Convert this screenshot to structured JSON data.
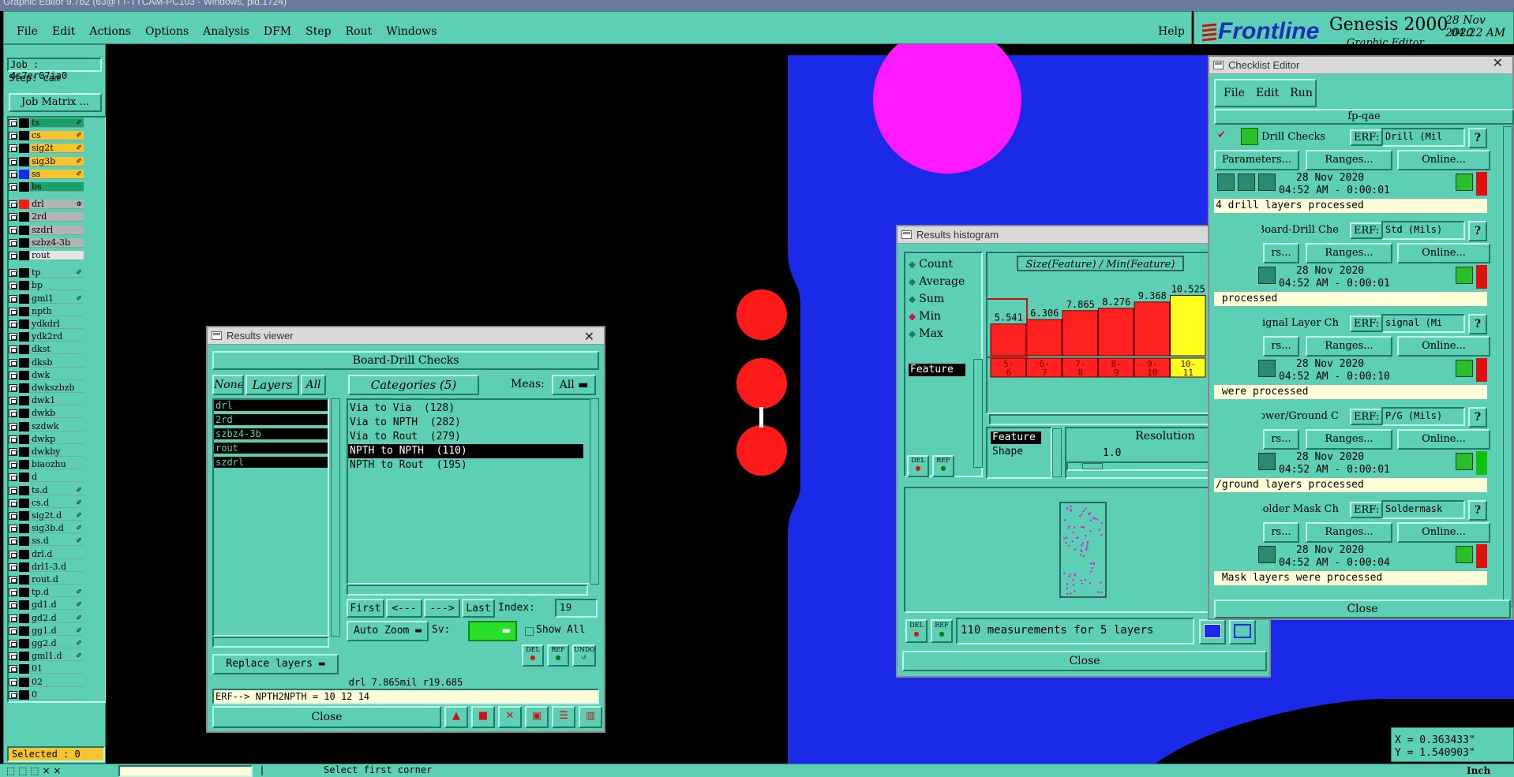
{
  "window": {
    "title": "Graphic Editor 9.7b2 (63@TT-TTCAM-PC103 - Windows, pid.1724)"
  },
  "menu": [
    "File",
    "Edit",
    "Actions",
    "Options",
    "Analysis",
    "DFM",
    "Step",
    "Rout",
    "Windows"
  ],
  "help_label": "Help",
  "brand": {
    "logo": "Frontline",
    "product": "Genesis 2000",
    "subtitle": "Graphic Editor",
    "date": "28 Nov 2020",
    "time": "04:22 AM"
  },
  "job": {
    "job_label": "Job : 4s7er07ia0",
    "step_label": "Step: cam",
    "matrix_button": "Job Matrix ..."
  },
  "layers": [
    {
      "name": "ts",
      "color": "#1aa06a",
      "sw": "#000000",
      "mark": "✐"
    },
    {
      "name": "cs",
      "color": "#f5c430",
      "sw": "#000000",
      "mark": "✐"
    },
    {
      "name": "sig2t",
      "color": "#f5c430",
      "sw": "#000000",
      "mark": "✐"
    },
    {
      "name": "sig3b",
      "color": "#f5c430",
      "sw": "#000000",
      "mark": "✐"
    },
    {
      "name": "ss",
      "color": "#f5c430",
      "sw": "#1b29e8",
      "mark": "✐"
    },
    {
      "name": "bs",
      "color": "#1aa06a",
      "sw": "#000000",
      "mark": ""
    },
    {
      "name": "drl",
      "color": "#b4b4b4",
      "sw": "#ff1a1a",
      "mark": "⊕"
    },
    {
      "name": "2rd",
      "color": "#b4b4b4",
      "sw": "#000000",
      "mark": ""
    },
    {
      "name": "szdrl",
      "color": "#b4b4b4",
      "sw": "#000000",
      "mark": ""
    },
    {
      "name": "szbz4-3b",
      "color": "#b4b4b4",
      "sw": "#000000",
      "mark": ""
    },
    {
      "name": "rout",
      "color": "#e4e4e4",
      "sw": "#000000",
      "mark": ""
    },
    {
      "name": "tp",
      "color": "#5ccfb4",
      "sw": "#000000",
      "mark": "✐"
    },
    {
      "name": "bp",
      "color": "#5ccfb4",
      "sw": "#000000",
      "mark": ""
    },
    {
      "name": "gml1",
      "color": "#5ccfb4",
      "sw": "#000000",
      "mark": "✐"
    },
    {
      "name": "npth",
      "color": "#5ccfb4",
      "sw": "#000000",
      "mark": ""
    },
    {
      "name": "ydkdrl",
      "color": "#5ccfb4",
      "sw": "#000000",
      "mark": ""
    },
    {
      "name": "ydk2rd",
      "color": "#5ccfb4",
      "sw": "#000000",
      "mark": ""
    },
    {
      "name": "dkst",
      "color": "#5ccfb4",
      "sw": "#000000",
      "mark": ""
    },
    {
      "name": "dksb",
      "color": "#5ccfb4",
      "sw": "#000000",
      "mark": ""
    },
    {
      "name": "dwk",
      "color": "#5ccfb4",
      "sw": "#000000",
      "mark": ""
    },
    {
      "name": "dwkszbzb",
      "color": "#5ccfb4",
      "sw": "#000000",
      "mark": ""
    },
    {
      "name": "dwk1",
      "color": "#5ccfb4",
      "sw": "#000000",
      "mark": ""
    },
    {
      "name": "dwkb",
      "color": "#5ccfb4",
      "sw": "#000000",
      "mark": ""
    },
    {
      "name": "szdwk",
      "color": "#5ccfb4",
      "sw": "#000000",
      "mark": ""
    },
    {
      "name": "dwkp",
      "color": "#5ccfb4",
      "sw": "#000000",
      "mark": ""
    },
    {
      "name": "dwkby",
      "color": "#5ccfb4",
      "sw": "#000000",
      "mark": ""
    },
    {
      "name": "biaozhu",
      "color": "#5ccfb4",
      "sw": "#000000",
      "mark": ""
    },
    {
      "name": "d",
      "color": "#5ccfb4",
      "sw": "#000000",
      "mark": ""
    },
    {
      "name": "ts.d",
      "color": "#5ccfb4",
      "sw": "#000000",
      "mark": "✐"
    },
    {
      "name": "cs.d",
      "color": "#5ccfb4",
      "sw": "#000000",
      "mark": "✐"
    },
    {
      "name": "sig2t.d",
      "color": "#5ccfb4",
      "sw": "#000000",
      "mark": "✐"
    },
    {
      "name": "sig3b.d",
      "color": "#5ccfb4",
      "sw": "#000000",
      "mark": "✐"
    },
    {
      "name": "ss.d",
      "color": "#5ccfb4",
      "sw": "#000000",
      "mark": "✐"
    },
    {
      "name": "drl.d",
      "color": "#5ccfb4",
      "sw": "#000000",
      "mark": ""
    },
    {
      "name": "drl1-3.d",
      "color": "#5ccfb4",
      "sw": "#000000",
      "mark": ""
    },
    {
      "name": "rout.d",
      "color": "#5ccfb4",
      "sw": "#000000",
      "mark": ""
    },
    {
      "name": "tp.d",
      "color": "#5ccfb4",
      "sw": "#000000",
      "mark": "✐"
    },
    {
      "name": "gd1.d",
      "color": "#5ccfb4",
      "sw": "#000000",
      "mark": "✐"
    },
    {
      "name": "gd2.d",
      "color": "#5ccfb4",
      "sw": "#000000",
      "mark": "✐"
    },
    {
      "name": "gg1.d",
      "color": "#5ccfb4",
      "sw": "#000000",
      "mark": "✐"
    },
    {
      "name": "gg2.d",
      "color": "#5ccfb4",
      "sw": "#000000",
      "mark": "✐"
    },
    {
      "name": "gml1.d",
      "color": "#5ccfb4",
      "sw": "#000000",
      "mark": "✐"
    },
    {
      "name": "01",
      "color": "#5ccfb4",
      "sw": "#000000",
      "mark": ""
    },
    {
      "name": "02",
      "color": "#5ccfb4",
      "sw": "#000000",
      "mark": ""
    },
    {
      "name": "0",
      "color": "#5ccfb4",
      "sw": "#000000",
      "mark": ""
    }
  ],
  "selected_label": "Selected : 0",
  "status_prompt": "Select first corner",
  "coords": {
    "x": "X = 0.363433\"",
    "y": "Y = 1.540903\""
  },
  "units_label": "Inch",
  "results_viewer": {
    "title": "Results viewer",
    "header": "Board-Drill Checks",
    "none_btn": "None",
    "layers_btn": "Layers",
    "all_btn": "All",
    "categories_btn": "Categories (5)",
    "meas_label": "Meas:",
    "meas_value": "All",
    "layers": [
      "drl",
      "2rd",
      "szbz4-3b",
      "rout",
      "szdrl"
    ],
    "categories": [
      "Via to Via  (128)",
      "Via to NPTH  (282)",
      "Via to Rout  (279)",
      "NPTH to NPTH  (110)",
      "NPTH to Rout  (195)"
    ],
    "selected_category": 3,
    "first_btn": "First",
    "prev_btn": "<---",
    "next_btn": "--->",
    "last_btn": "Last",
    "index_label": "Index:",
    "index_value": "19",
    "auto_zoom": "Auto Zoom",
    "sv_label": "Sv:",
    "show_all": "Show All",
    "replace_layers": "Replace layers",
    "del_label": "DEL",
    "ref_label": "REF",
    "undo_label": "UNDO",
    "info_line": "drl 7.865mil  r19.685",
    "erf_line": "ERF--> NPTH2NPTH = 10 12 14",
    "close_btn": "Close"
  },
  "histogram": {
    "title": "Results histogram",
    "radios": [
      "Count",
      "Average",
      "Sum",
      "Min",
      "Max"
    ],
    "selected_radio": "Min",
    "feature_tab": "Feature",
    "chart_title": "Size(Feature) / Min(Feature)",
    "resolution_label": "Resolution",
    "resolution_value": "1.0",
    "feature_opt": "Feature",
    "shape_opt": "Shape",
    "summary": "110 measurements for 5 layers",
    "del_label": "DEL",
    "ref_label": "REF",
    "close_btn": "Close"
  },
  "chart_data": {
    "type": "bar",
    "title": "Size(Feature) / Min(Feature)",
    "categories": [
      "5-6",
      "6-7",
      "7-8",
      "8-9",
      "9-10",
      "10-11"
    ],
    "values": [
      5.541,
      6.306,
      7.865,
      8.276,
      9.368,
      10.525
    ],
    "value_labels": [
      "5.541",
      "6.306",
      "7.865",
      "8.276",
      "9.368",
      "10.525"
    ],
    "cat_top": [
      "5-",
      "6-",
      "7-",
      "8-",
      "9-",
      "10-"
    ],
    "cat_bottom": [
      "6",
      "7",
      "8",
      "9",
      "10",
      "11"
    ],
    "highlight_index": 5,
    "bar_color": "#ff2020",
    "highlight_color": "#ffff20",
    "ylim": [
      0,
      11
    ]
  },
  "checklist": {
    "title": "Checklist Editor",
    "menu": [
      "File",
      "Edit",
      "Run"
    ],
    "name": "fp-qae",
    "erf_label": "ERF:",
    "params_btn": "Parameters...",
    "params_short": "rs...",
    "ranges_btn": "Ranges...",
    "online_btn": "Online...",
    "help": "?",
    "checks": [
      {
        "name": "Drill Checks",
        "erf": "Drill (Mil",
        "date": "28 Nov 2020",
        "time": "04:52 AM - 0:00:01",
        "result": "4 drill layers processed",
        "status_color": "#e01010"
      },
      {
        "name": "Board-Drill Che",
        "erf": "Std (Mils)",
        "date": "28 Nov 2020",
        "time": "04:52 AM - 0:00:01",
        "result": " processed",
        "status_color": "#e01010"
      },
      {
        "name": "Signal Layer Ch",
        "erf": "signal (Mi",
        "date": "28 Nov 2020",
        "time": "04:52 AM - 0:00:10",
        "result": " were processed",
        "status_color": "#e01010"
      },
      {
        "name": "Power/Ground C",
        "erf": "P/G (Mils)",
        "date": "28 Nov 2020",
        "time": "04:52 AM - 0:00:01",
        "result": "/ground layers processed",
        "status_color": "#10c010"
      },
      {
        "name": "Solder Mask Ch",
        "erf": "Soldermask",
        "date": "28 Nov 2020",
        "time": "04:52 AM - 0:00:04",
        "result": " Mask layers were processed",
        "status_color": "#e01010"
      }
    ],
    "close_btn": "Close"
  }
}
